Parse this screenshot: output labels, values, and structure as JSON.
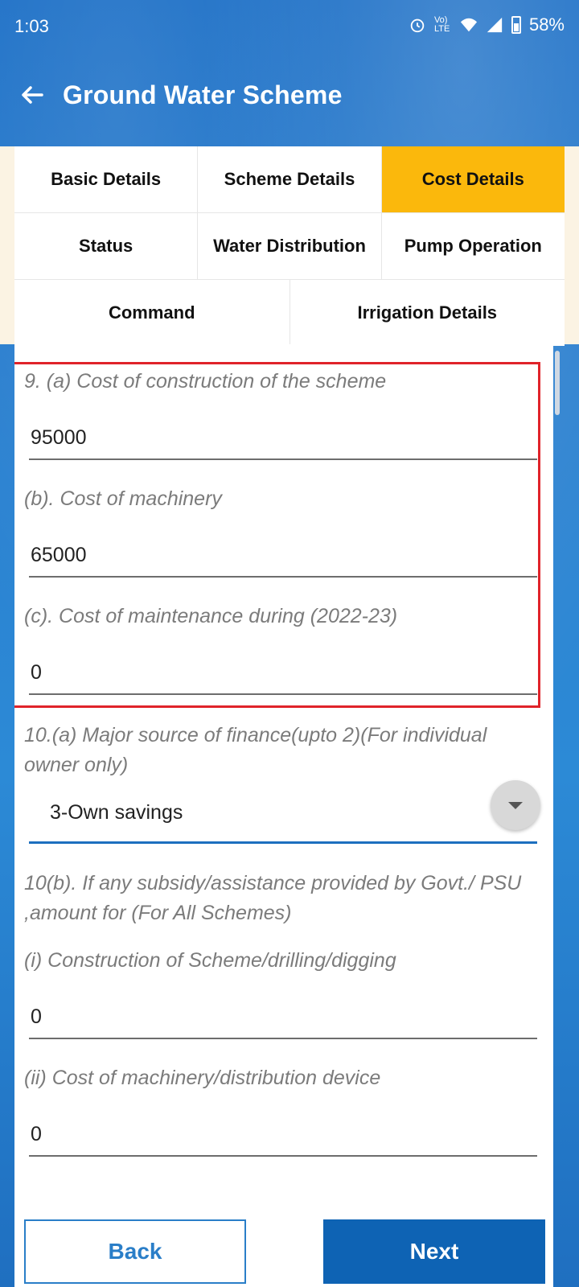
{
  "status_bar": {
    "time": "1:03",
    "network_label": "Vo) LTE",
    "battery": "58%"
  },
  "app_bar": {
    "title": "Ground Water Scheme",
    "back_icon": "arrow-left-icon"
  },
  "tabs": {
    "row1": [
      "Basic Details",
      "Scheme Details",
      "Cost Details"
    ],
    "row2": [
      "Status",
      "Water Distribution",
      "Pump Operation"
    ],
    "row3": [
      "Command",
      "Irrigation Details"
    ],
    "active": "Cost Details"
  },
  "form": {
    "q9a_label": "9. (a) Cost of construction of the scheme",
    "q9a_value": "95000",
    "q9b_label": "(b). Cost of machinery",
    "q9b_value": "65000",
    "q9c_label": "(c). Cost of maintenance during (2022-23)",
    "q9c_value": "0",
    "q10a_label": "10.(a) Major source of finance(upto 2)(For individual owner only)",
    "q10a_selected": "3-Own savings",
    "q10b_label": "10(b). If any subsidy/assistance provided by Govt./ PSU ,amount for (For All Schemes)",
    "q10b_i_label": "(i) Construction of Scheme/drilling/digging",
    "q10b_i_value": "0",
    "q10b_ii_label": "(ii) Cost of machinery/distribution device",
    "q10b_ii_value": "0"
  },
  "buttons": {
    "back": "Back",
    "next": "Next"
  },
  "colors": {
    "primary": "#0e63b4",
    "active_tab": "#fbb80c",
    "highlight": "#e0232a"
  }
}
